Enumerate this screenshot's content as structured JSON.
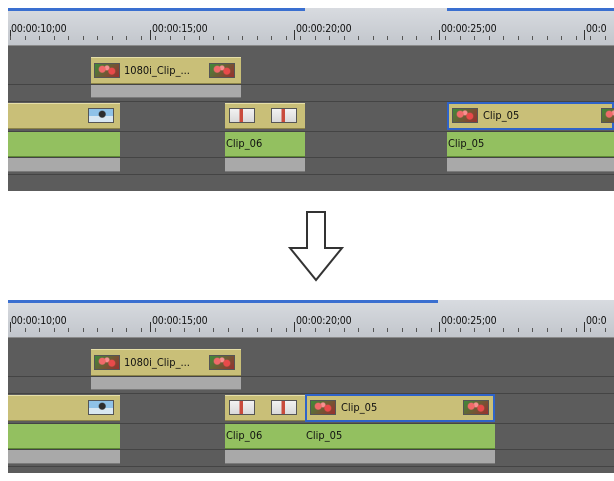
{
  "timecodes": [
    "00:00:10;00",
    "00:00:15;00",
    "00:00:20;00",
    "00:00:25;00",
    "00:0"
  ],
  "before": {
    "title_clip": "1080i_Clip_...",
    "video_clip": "Clip_05",
    "audio_clips": [
      "Clip_06",
      "Clip_05"
    ]
  },
  "after": {
    "title_clip": "1080i_Clip_...",
    "video_clip": "Clip_05",
    "audio_clips": [
      "Clip_06",
      "Clip_05"
    ]
  },
  "arrow_icon": "down-arrow-icon",
  "colors": {
    "ruler": "#c8ccd2",
    "video_clip": "#c9bf78",
    "audio_clip": "#93c060",
    "selection": "#2f63c8",
    "playbar": "#3a6fd0"
  }
}
